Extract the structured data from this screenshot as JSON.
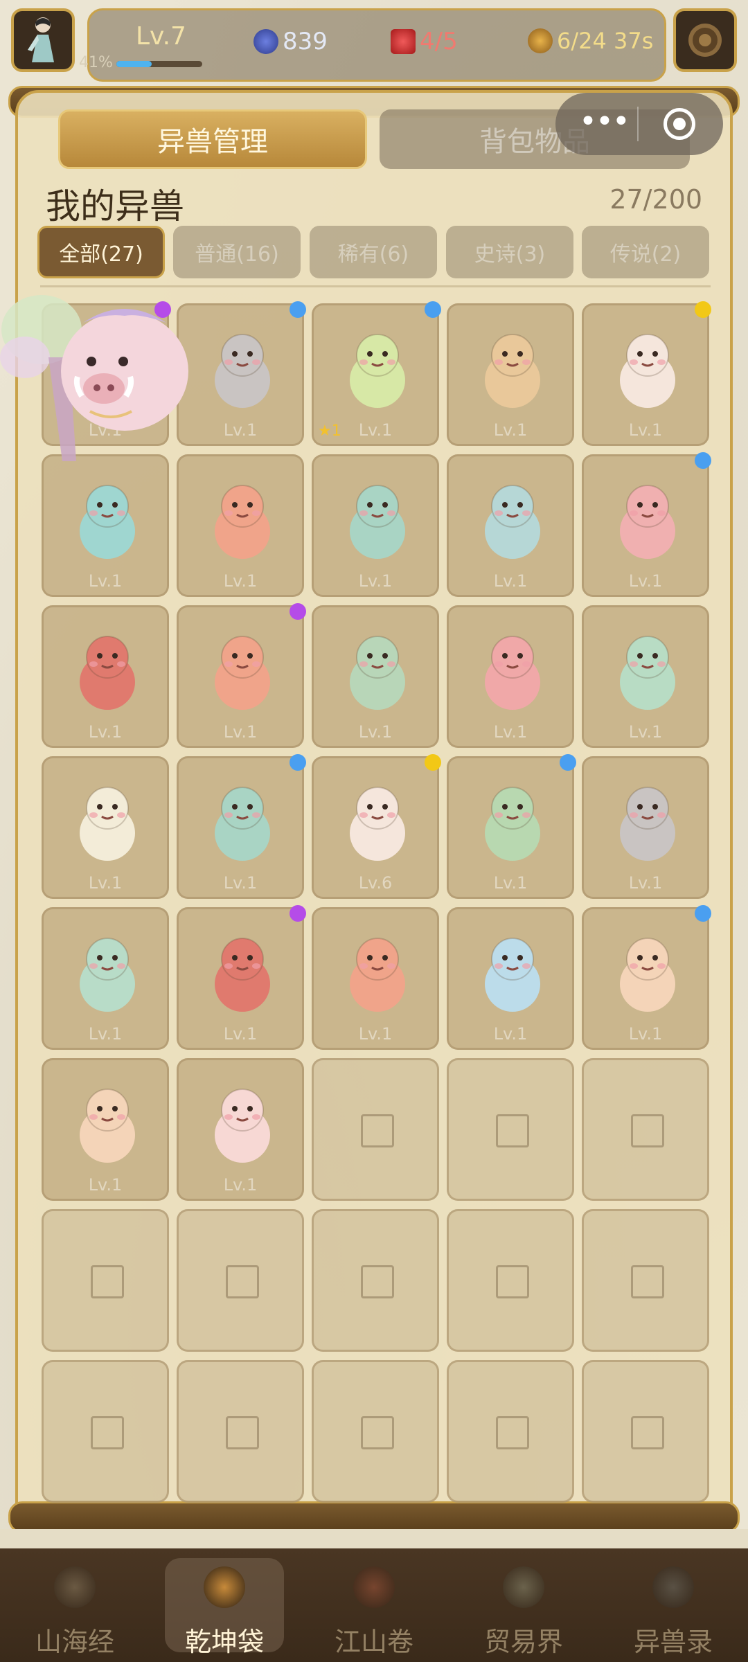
{
  "header": {
    "level": "Lv.7",
    "xp_percent_label": "41%",
    "xp_fraction": 0.41,
    "gems": "839",
    "hearts": "4/5",
    "energy": "6/24 37s"
  },
  "tabs": [
    {
      "label": "异兽管理",
      "active": true
    },
    {
      "label": "背包物品",
      "active": false
    }
  ],
  "section": {
    "title": "我的异兽",
    "count": "27/200"
  },
  "filters": [
    {
      "label": "全部(27)",
      "active": true
    },
    {
      "label": "普通(16)",
      "active": false
    },
    {
      "label": "稀有(6)",
      "active": false
    },
    {
      "label": "史诗(3)",
      "active": false
    },
    {
      "label": "传说(2)",
      "active": false
    }
  ],
  "colors": {
    "purple": "#b54ce8",
    "blue": "#4a9ff0",
    "yellow": "#f2c816"
  },
  "beasts": [
    {
      "icon": "boar-icon",
      "level": "Lv.1",
      "rarity_dot": "purple",
      "tint": "#f2d4d8"
    },
    {
      "icon": "wolf-icon",
      "level": "Lv.1",
      "rarity_dot": "blue",
      "tint": "#c9c4c2"
    },
    {
      "icon": "owl-icon",
      "level": "Lv.1",
      "rarity_dot": "blue",
      "tint": "#d7e8a6",
      "star": "★1"
    },
    {
      "icon": "pig-icon",
      "level": "Lv.1",
      "rarity_dot": "",
      "tint": "#e9c89a"
    },
    {
      "icon": "tiger-icon",
      "level": "Lv.1",
      "rarity_dot": "yellow",
      "tint": "#f5e6dc"
    },
    {
      "icon": "serpent-icon",
      "level": "Lv.1",
      "rarity_dot": "",
      "tint": "#9fd6d0"
    },
    {
      "icon": "bird-icon",
      "level": "Lv.1",
      "rarity_dot": "",
      "tint": "#f0a48a"
    },
    {
      "icon": "winged-serpent-icon",
      "level": "Lv.1",
      "rarity_dot": "",
      "tint": "#a9d4c4"
    },
    {
      "icon": "hydra-icon",
      "level": "Lv.1",
      "rarity_dot": "",
      "tint": "#b6d7d6"
    },
    {
      "icon": "twin-snake-icon",
      "level": "Lv.1",
      "rarity_dot": "blue",
      "tint": "#f0b0b0"
    },
    {
      "icon": "winged-orb-icon",
      "level": "Lv.1",
      "rarity_dot": "",
      "tint": "#e07a6e"
    },
    {
      "icon": "bird-icon",
      "level": "Lv.1",
      "rarity_dot": "purple",
      "tint": "#f0a48a"
    },
    {
      "icon": "warrior-beast-icon",
      "level": "Lv.1",
      "rarity_dot": "",
      "tint": "#b8d6b8"
    },
    {
      "icon": "twin-snake-icon",
      "level": "Lv.1",
      "rarity_dot": "",
      "tint": "#f0a8a8"
    },
    {
      "icon": "unicorn-beast-icon",
      "level": "Lv.1",
      "rarity_dot": "",
      "tint": "#b8dcc4"
    },
    {
      "icon": "ram-icon",
      "level": "Lv.1",
      "rarity_dot": "",
      "tint": "#f3ecd8"
    },
    {
      "icon": "winged-serpent-icon",
      "level": "Lv.1",
      "rarity_dot": "blue",
      "tint": "#a9d4c4"
    },
    {
      "icon": "tiger-icon",
      "level": "Lv.6",
      "rarity_dot": "yellow",
      "tint": "#f5e6dc"
    },
    {
      "icon": "ram-icon",
      "level": "Lv.1",
      "rarity_dot": "blue",
      "tint": "#b8d8b0"
    },
    {
      "icon": "wolf-icon",
      "level": "Lv.1",
      "rarity_dot": "",
      "tint": "#c9c4c2"
    },
    {
      "icon": "dragon-beast-icon",
      "level": "Lv.1",
      "rarity_dot": "",
      "tint": "#b8dcc8"
    },
    {
      "icon": "winged-orb-icon",
      "level": "Lv.1",
      "rarity_dot": "purple",
      "tint": "#e07a6e"
    },
    {
      "icon": "bird-icon",
      "level": "Lv.1",
      "rarity_dot": "",
      "tint": "#f0a48a"
    },
    {
      "icon": "dragon-icon",
      "level": "Lv.1",
      "rarity_dot": "",
      "tint": "#bcdcea"
    },
    {
      "icon": "lion-icon",
      "level": "Lv.1",
      "rarity_dot": "blue",
      "tint": "#f4d4b8"
    },
    {
      "icon": "lion-icon",
      "level": "Lv.1",
      "rarity_dot": "",
      "tint": "#f4d4b8"
    },
    {
      "icon": "pig-icon",
      "level": "Lv.1",
      "rarity_dot": "",
      "tint": "#f7d8d4"
    }
  ],
  "empty_slots": 13,
  "nav": [
    {
      "label": "山海经",
      "icon": "scroll-icon",
      "active": false
    },
    {
      "label": "乾坤袋",
      "icon": "bag-icon",
      "active": true
    },
    {
      "label": "江山卷",
      "icon": "pavilion-icon",
      "active": false
    },
    {
      "label": "贸易界",
      "icon": "trade-icon",
      "active": false
    },
    {
      "label": "异兽录",
      "icon": "swords-icon",
      "active": false
    }
  ]
}
